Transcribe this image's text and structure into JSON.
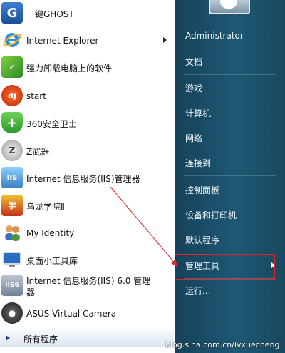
{
  "programs": [
    {
      "label": "一键GHOST",
      "icon": "ghost-g-icon"
    },
    {
      "label": "Internet Explorer",
      "icon": "internet-explorer-icon",
      "has_submenu": true
    },
    {
      "label": "强力卸载电脑上的软件",
      "icon": "uninstall-icon"
    },
    {
      "label": "start",
      "icon": "start-red-icon"
    },
    {
      "label": "360安全卫士",
      "icon": "360-shield-icon"
    },
    {
      "label": "Z武器",
      "icon": "z-weapon-icon"
    },
    {
      "label": "Internet 信息服务(IIS)管理器",
      "icon": "iis-manager-icon"
    },
    {
      "label": "乌龙学院Ⅱ",
      "icon": "wulong-academy-icon"
    },
    {
      "label": "My Identity",
      "icon": "identity-users-icon"
    },
    {
      "label": "桌面小工具库",
      "icon": "desktop-gadgets-icon"
    },
    {
      "label_line1": "Internet 信息服务(IIS) 6.0 管理",
      "label_line2": "器",
      "icon": "iis6-manager-icon"
    },
    {
      "label": "ASUS Virtual Camera",
      "icon": "webcam-icon"
    }
  ],
  "all_programs_label": "所有程序",
  "right_items": [
    {
      "label": "Administrator"
    },
    {
      "label": "文档"
    },
    {
      "label": "游戏"
    },
    {
      "label": "计算机"
    },
    {
      "label": "网络"
    },
    {
      "label": "连接到"
    },
    {
      "label": "控制面板"
    },
    {
      "label": "设备和打印机"
    },
    {
      "label": "默认程序"
    },
    {
      "label": "管理工具",
      "has_submenu": true
    },
    {
      "label": "运行..."
    }
  ],
  "watermark": "blog.sina.com.cn/lvxuecheng",
  "colors": {
    "highlight_box": "#e0242a",
    "right_pane": "#1d5874"
  }
}
